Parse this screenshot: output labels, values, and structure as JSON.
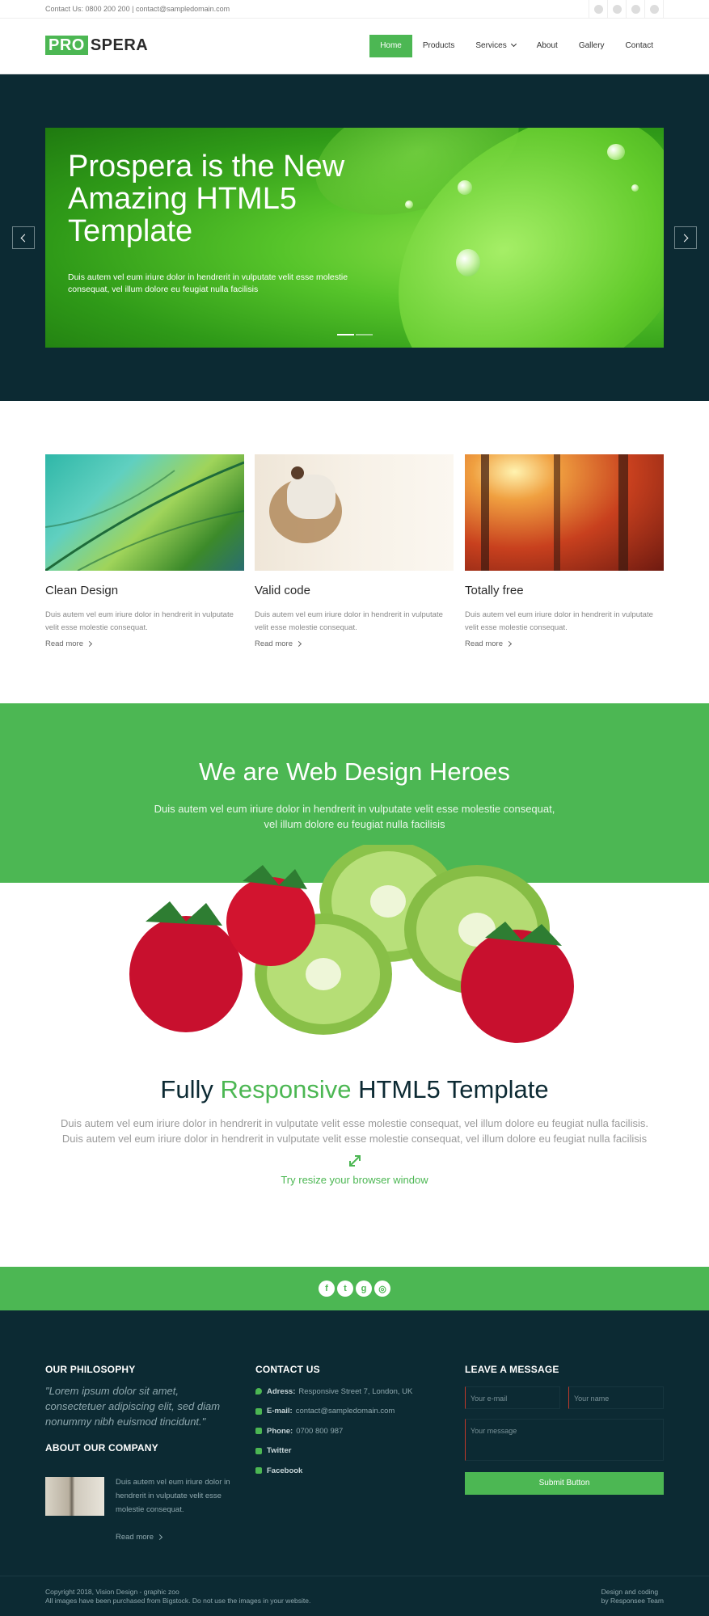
{
  "topbar": {
    "contact_prefix": "Contact Us: 0800 200 200",
    "email": "contact@sampledomain.com",
    "socials": [
      "facebook-icon",
      "twitter-icon",
      "googleplus-icon",
      "instagram-icon"
    ]
  },
  "header": {
    "logo_pro": "PRO",
    "logo_spera": "SPERA",
    "nav": [
      {
        "label": "Home",
        "active": true
      },
      {
        "label": "Products",
        "active": false
      },
      {
        "label": "Services",
        "active": false,
        "dropdown": true
      },
      {
        "label": "About",
        "active": false
      },
      {
        "label": "Gallery",
        "active": false
      },
      {
        "label": "Contact",
        "active": false
      }
    ]
  },
  "hero": {
    "title": "Prospera is the New Amazing HTML5 Template",
    "text": "Duis autem vel eum iriure dolor in hendrerit in vulputate velit esse molestie consequat, vel illum dolore eu feugiat nulla facilisis",
    "slides": 2,
    "active_slide": 1
  },
  "features": [
    {
      "title": "Clean Design",
      "text": "Duis autem vel eum iriure dolor in hendrerit in vulputate velit esse molestie consequat.",
      "more": "Read more"
    },
    {
      "title": "Valid code",
      "text": "Duis autem vel eum iriure dolor in hendrerit in vulputate velit esse molestie consequat.",
      "more": "Read more"
    },
    {
      "title": "Totally free",
      "text": "Duis autem vel eum iriure dolor in hendrerit in vulputate velit esse molestie consequat.",
      "more": "Read more"
    }
  ],
  "band": {
    "title": "We are Web Design Heroes",
    "text": "Duis autem vel eum iriure dolor in hendrerit in vulputate velit esse molestie consequat, vel illum dolore eu feugiat nulla facilisis"
  },
  "responsive": {
    "title_a": "Fully ",
    "title_b": "Responsive",
    "title_c": " HTML5 Template",
    "text": "Duis autem vel eum iriure dolor in hendrerit in vulputate velit esse molestie consequat, vel illum dolore eu feugiat nulla facilisis. Duis autem vel eum iriure dolor in hendrerit in vulputate velit esse molestie consequat, vel illum dolore eu feugiat nulla facilisis",
    "try": "Try resize your browser window"
  },
  "footer": {
    "philosophy_title": "OUR PHILOSOPHY",
    "philosophy_quote": "\"Lorem ipsum dolor sit amet, consectetuer adipiscing elit, sed diam nonummy nibh euismod tincidunt.\"",
    "company_title": "ABOUT OUR COMPANY",
    "company_text": "Duis autem vel eum iriure dolor in hendrerit in vulputate velit esse molestie consequat.",
    "company_more": "Read more",
    "contact_title": "CONTACT US",
    "contact": [
      {
        "label": "Adress:",
        "value": "Responsive Street 7, London, UK"
      },
      {
        "label": "E-mail:",
        "value": "contact@sampledomain.com"
      },
      {
        "label": "Phone:",
        "value": "0700 800 987"
      },
      {
        "label": "Twitter",
        "value": ""
      },
      {
        "label": "Facebook",
        "value": ""
      }
    ],
    "message_title": "LEAVE A MESSAGE",
    "email_placeholder": "Your e-mail",
    "name_placeholder": "Your name",
    "message_placeholder": "Your message",
    "submit_label": "Submit Button",
    "copyright_1": "Copyright 2018, Vision Design - graphic zoo",
    "copyright_2": "All images have been purchased from Bigstock. Do not use the images in your website.",
    "credit_1": "Design and coding",
    "credit_2": "by Responsee Team"
  },
  "colors": {
    "accent": "#4cb753",
    "dark": "#0c2a33"
  }
}
